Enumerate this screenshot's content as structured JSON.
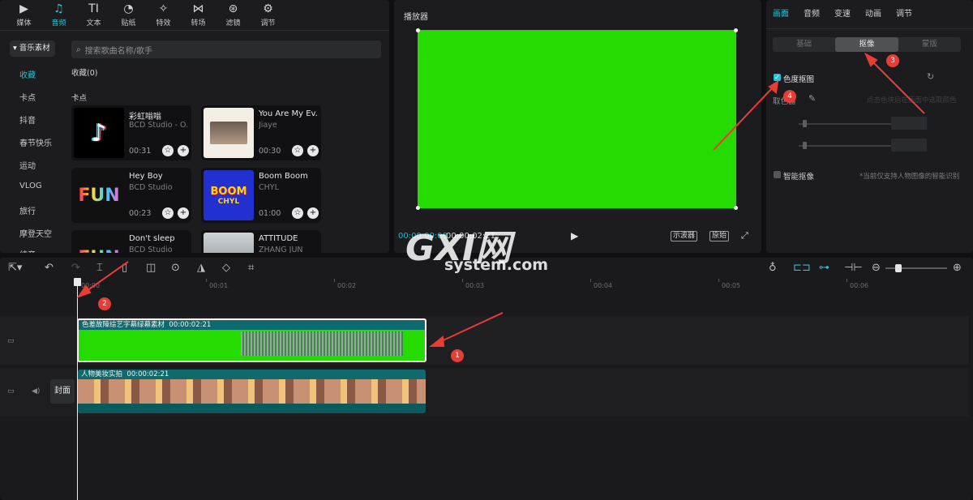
{
  "media": {
    "tabs": [
      {
        "label": "媒体",
        "icon": "media-icon",
        "glyph": "▶"
      },
      {
        "label": "音频",
        "icon": "audio-icon",
        "glyph": "♫"
      },
      {
        "label": "文本",
        "icon": "text-icon",
        "glyph": "TI"
      },
      {
        "label": "贴纸",
        "icon": "sticker-icon",
        "glyph": "◔"
      },
      {
        "label": "特效",
        "icon": "effects-icon",
        "glyph": "✧"
      },
      {
        "label": "转场",
        "icon": "transition-icon",
        "glyph": "⋈"
      },
      {
        "label": "滤镜",
        "icon": "filter-icon",
        "glyph": "⊛"
      },
      {
        "label": "调节",
        "icon": "adjust-icon",
        "glyph": "⚙"
      }
    ],
    "active_tab": 1,
    "category": "音乐素材",
    "side_items": [
      "收藏",
      "卡点",
      "抖音",
      "春节快乐",
      "运动",
      "VLOG",
      "旅行",
      "摩登天空",
      "纯音"
    ],
    "search_placeholder": "搜索歌曲名称/歌手",
    "favorites_label": "收藏(0)",
    "section_label": "卡点",
    "songs": [
      {
        "title": "彩虹嗡嗡",
        "artist": "BCD Studio - O...",
        "duration": "00:31"
      },
      {
        "title": "You Are My Ev...",
        "artist": "Jiaye",
        "duration": "00:30"
      },
      {
        "title": "Hey Boy",
        "artist": "BCD Studio",
        "duration": "00:23"
      },
      {
        "title": "Boom Boom",
        "artist": "CHYL",
        "duration": "01:00"
      },
      {
        "title": "Don't sleep",
        "artist": "BCD Studio",
        "duration": ""
      },
      {
        "title": "ATTITUDE",
        "artist": "ZHANG JUN",
        "duration": ""
      }
    ],
    "thumb_text": {
      "fun": "FUN",
      "boom": "BOOM",
      "chyl": "CHYL"
    }
  },
  "player": {
    "title": "播放器",
    "current_time": "00:00:00:00",
    "total_time": "00:00:02:21",
    "scope_btn": "示波器",
    "original_btn": "原始"
  },
  "props": {
    "tabs": [
      "画面",
      "音频",
      "变速",
      "动画",
      "调节"
    ],
    "active_tab": 0,
    "segments": [
      "基础",
      "抠像",
      "蒙版"
    ],
    "active_segment": 1,
    "chroma_label": "色度抠图",
    "chroma_checked": true,
    "picker_label": "取色器",
    "picker_hint": "点击色块后在画面中选取颜色",
    "smart_label": "智能抠像",
    "smart_note": "*当前仅支持人物图像的智能识别"
  },
  "timeline": {
    "ruler": [
      "00:00",
      "00:01",
      "00:02",
      "00:03",
      "00:04",
      "00:05",
      "00:06"
    ],
    "clip1": {
      "name": "色差故障综艺字幕绿幕素材",
      "duration": "00:00:02:21"
    },
    "clip2": {
      "name": "人物美妆实拍",
      "duration": "00:00:02:21"
    },
    "cover_label": "封面"
  },
  "annotations": [
    "1",
    "2",
    "3",
    "4"
  ],
  "watermark": {
    "line1": "GXI网",
    "line2": "system.com"
  },
  "colors": {
    "accent": "#22c3d8",
    "green_screen": "#25db00",
    "annotation": "#e83d35"
  }
}
